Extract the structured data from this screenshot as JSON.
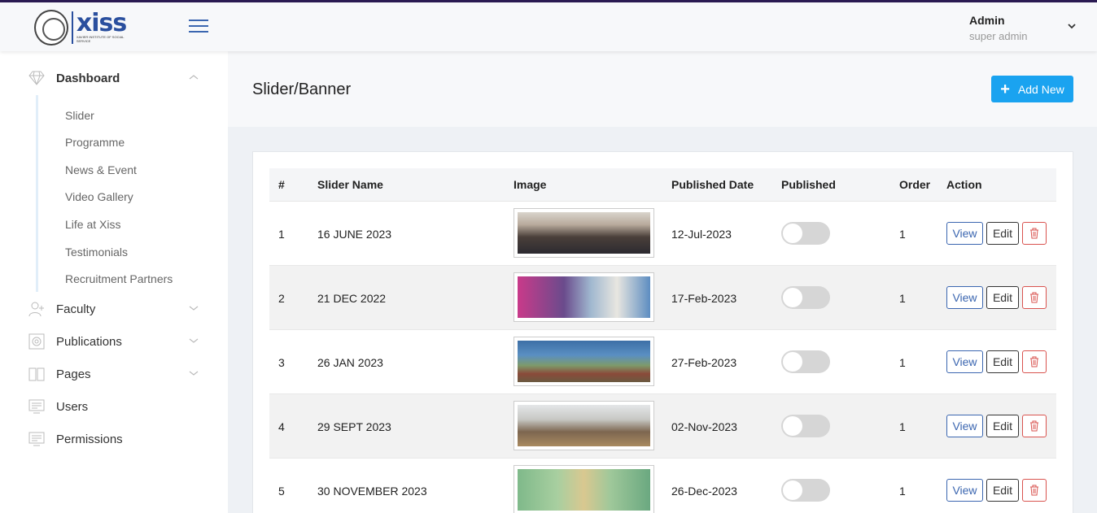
{
  "header": {
    "logo_word": "xiss",
    "logo_sub": "XAVIER INSTITUTE OF SOCIAL SERVICE",
    "user_name": "Admin",
    "user_role": "super admin"
  },
  "sidebar": {
    "dashboard_label": "Dashboard",
    "sub_items": [
      "Slider",
      "Programme",
      "News & Event",
      "Video Gallery",
      "Life at Xiss",
      "Testimonials",
      "Recruitment Partners"
    ],
    "items": [
      {
        "label": "Faculty",
        "icon": "add-user-icon",
        "has_children": true
      },
      {
        "label": "Publications",
        "icon": "book-icon",
        "has_children": true
      },
      {
        "label": "Pages",
        "icon": "open-book-icon",
        "has_children": true
      },
      {
        "label": "Users",
        "icon": "monitor-icon",
        "has_children": false
      },
      {
        "label": "Permissions",
        "icon": "monitor-icon",
        "has_children": false
      }
    ]
  },
  "main": {
    "page_title": "Slider/Banner",
    "add_new_label": "Add New"
  },
  "table": {
    "columns": [
      "#",
      "Slider Name",
      "Image",
      "Published Date",
      "Published",
      "Order",
      "Action"
    ],
    "rows": [
      {
        "num": "1",
        "name": "16 JUNE 2023",
        "date": "12-Jul-2023",
        "published": false,
        "order": "1"
      },
      {
        "num": "2",
        "name": "21 DEC 2022",
        "date": "17-Feb-2023",
        "published": false,
        "order": "1"
      },
      {
        "num": "3",
        "name": "26 JAN 2023",
        "date": "27-Feb-2023",
        "published": false,
        "order": "1"
      },
      {
        "num": "4",
        "name": "29 SEPT 2023",
        "date": "02-Nov-2023",
        "published": false,
        "order": "1"
      },
      {
        "num": "5",
        "name": "30 NOVEMBER 2023",
        "date": "26-Dec-2023",
        "published": false,
        "order": "1"
      }
    ],
    "view_label": "View",
    "edit_label": "Edit"
  },
  "colors": {
    "accent": "#1aa3f0",
    "brand": "#2a4f9e",
    "topline": "#2b1b52",
    "danger": "#d9534f"
  }
}
